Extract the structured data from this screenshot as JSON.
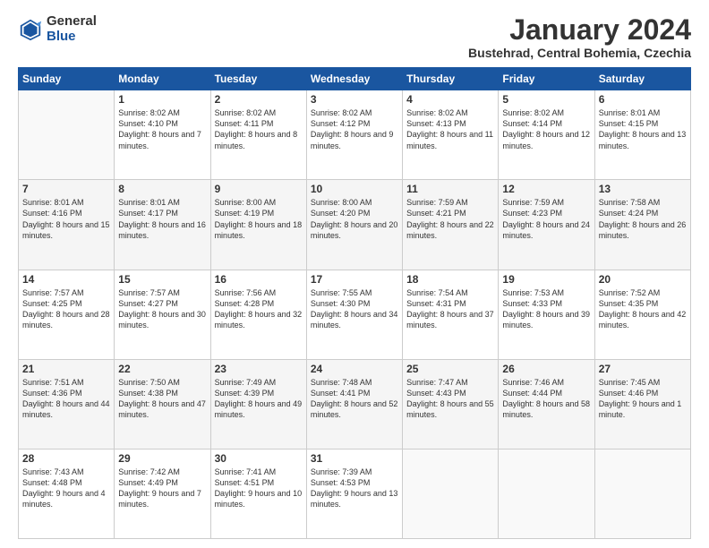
{
  "header": {
    "logo_general": "General",
    "logo_blue": "Blue",
    "month_title": "January 2024",
    "location": "Bustehrad, Central Bohemia, Czechia"
  },
  "days_of_week": [
    "Sunday",
    "Monday",
    "Tuesday",
    "Wednesday",
    "Thursday",
    "Friday",
    "Saturday"
  ],
  "weeks": [
    [
      {
        "day": "",
        "sunrise": "",
        "sunset": "",
        "daylight": ""
      },
      {
        "day": "1",
        "sunrise": "Sunrise: 8:02 AM",
        "sunset": "Sunset: 4:10 PM",
        "daylight": "Daylight: 8 hours and 7 minutes."
      },
      {
        "day": "2",
        "sunrise": "Sunrise: 8:02 AM",
        "sunset": "Sunset: 4:11 PM",
        "daylight": "Daylight: 8 hours and 8 minutes."
      },
      {
        "day": "3",
        "sunrise": "Sunrise: 8:02 AM",
        "sunset": "Sunset: 4:12 PM",
        "daylight": "Daylight: 8 hours and 9 minutes."
      },
      {
        "day": "4",
        "sunrise": "Sunrise: 8:02 AM",
        "sunset": "Sunset: 4:13 PM",
        "daylight": "Daylight: 8 hours and 11 minutes."
      },
      {
        "day": "5",
        "sunrise": "Sunrise: 8:02 AM",
        "sunset": "Sunset: 4:14 PM",
        "daylight": "Daylight: 8 hours and 12 minutes."
      },
      {
        "day": "6",
        "sunrise": "Sunrise: 8:01 AM",
        "sunset": "Sunset: 4:15 PM",
        "daylight": "Daylight: 8 hours and 13 minutes."
      }
    ],
    [
      {
        "day": "7",
        "sunrise": "Sunrise: 8:01 AM",
        "sunset": "Sunset: 4:16 PM",
        "daylight": "Daylight: 8 hours and 15 minutes."
      },
      {
        "day": "8",
        "sunrise": "Sunrise: 8:01 AM",
        "sunset": "Sunset: 4:17 PM",
        "daylight": "Daylight: 8 hours and 16 minutes."
      },
      {
        "day": "9",
        "sunrise": "Sunrise: 8:00 AM",
        "sunset": "Sunset: 4:19 PM",
        "daylight": "Daylight: 8 hours and 18 minutes."
      },
      {
        "day": "10",
        "sunrise": "Sunrise: 8:00 AM",
        "sunset": "Sunset: 4:20 PM",
        "daylight": "Daylight: 8 hours and 20 minutes."
      },
      {
        "day": "11",
        "sunrise": "Sunrise: 7:59 AM",
        "sunset": "Sunset: 4:21 PM",
        "daylight": "Daylight: 8 hours and 22 minutes."
      },
      {
        "day": "12",
        "sunrise": "Sunrise: 7:59 AM",
        "sunset": "Sunset: 4:23 PM",
        "daylight": "Daylight: 8 hours and 24 minutes."
      },
      {
        "day": "13",
        "sunrise": "Sunrise: 7:58 AM",
        "sunset": "Sunset: 4:24 PM",
        "daylight": "Daylight: 8 hours and 26 minutes."
      }
    ],
    [
      {
        "day": "14",
        "sunrise": "Sunrise: 7:57 AM",
        "sunset": "Sunset: 4:25 PM",
        "daylight": "Daylight: 8 hours and 28 minutes."
      },
      {
        "day": "15",
        "sunrise": "Sunrise: 7:57 AM",
        "sunset": "Sunset: 4:27 PM",
        "daylight": "Daylight: 8 hours and 30 minutes."
      },
      {
        "day": "16",
        "sunrise": "Sunrise: 7:56 AM",
        "sunset": "Sunset: 4:28 PM",
        "daylight": "Daylight: 8 hours and 32 minutes."
      },
      {
        "day": "17",
        "sunrise": "Sunrise: 7:55 AM",
        "sunset": "Sunset: 4:30 PM",
        "daylight": "Daylight: 8 hours and 34 minutes."
      },
      {
        "day": "18",
        "sunrise": "Sunrise: 7:54 AM",
        "sunset": "Sunset: 4:31 PM",
        "daylight": "Daylight: 8 hours and 37 minutes."
      },
      {
        "day": "19",
        "sunrise": "Sunrise: 7:53 AM",
        "sunset": "Sunset: 4:33 PM",
        "daylight": "Daylight: 8 hours and 39 minutes."
      },
      {
        "day": "20",
        "sunrise": "Sunrise: 7:52 AM",
        "sunset": "Sunset: 4:35 PM",
        "daylight": "Daylight: 8 hours and 42 minutes."
      }
    ],
    [
      {
        "day": "21",
        "sunrise": "Sunrise: 7:51 AM",
        "sunset": "Sunset: 4:36 PM",
        "daylight": "Daylight: 8 hours and 44 minutes."
      },
      {
        "day": "22",
        "sunrise": "Sunrise: 7:50 AM",
        "sunset": "Sunset: 4:38 PM",
        "daylight": "Daylight: 8 hours and 47 minutes."
      },
      {
        "day": "23",
        "sunrise": "Sunrise: 7:49 AM",
        "sunset": "Sunset: 4:39 PM",
        "daylight": "Daylight: 8 hours and 49 minutes."
      },
      {
        "day": "24",
        "sunrise": "Sunrise: 7:48 AM",
        "sunset": "Sunset: 4:41 PM",
        "daylight": "Daylight: 8 hours and 52 minutes."
      },
      {
        "day": "25",
        "sunrise": "Sunrise: 7:47 AM",
        "sunset": "Sunset: 4:43 PM",
        "daylight": "Daylight: 8 hours and 55 minutes."
      },
      {
        "day": "26",
        "sunrise": "Sunrise: 7:46 AM",
        "sunset": "Sunset: 4:44 PM",
        "daylight": "Daylight: 8 hours and 58 minutes."
      },
      {
        "day": "27",
        "sunrise": "Sunrise: 7:45 AM",
        "sunset": "Sunset: 4:46 PM",
        "daylight": "Daylight: 9 hours and 1 minute."
      }
    ],
    [
      {
        "day": "28",
        "sunrise": "Sunrise: 7:43 AM",
        "sunset": "Sunset: 4:48 PM",
        "daylight": "Daylight: 9 hours and 4 minutes."
      },
      {
        "day": "29",
        "sunrise": "Sunrise: 7:42 AM",
        "sunset": "Sunset: 4:49 PM",
        "daylight": "Daylight: 9 hours and 7 minutes."
      },
      {
        "day": "30",
        "sunrise": "Sunrise: 7:41 AM",
        "sunset": "Sunset: 4:51 PM",
        "daylight": "Daylight: 9 hours and 10 minutes."
      },
      {
        "day": "31",
        "sunrise": "Sunrise: 7:39 AM",
        "sunset": "Sunset: 4:53 PM",
        "daylight": "Daylight: 9 hours and 13 minutes."
      },
      {
        "day": "",
        "sunrise": "",
        "sunset": "",
        "daylight": ""
      },
      {
        "day": "",
        "sunrise": "",
        "sunset": "",
        "daylight": ""
      },
      {
        "day": "",
        "sunrise": "",
        "sunset": "",
        "daylight": ""
      }
    ]
  ]
}
